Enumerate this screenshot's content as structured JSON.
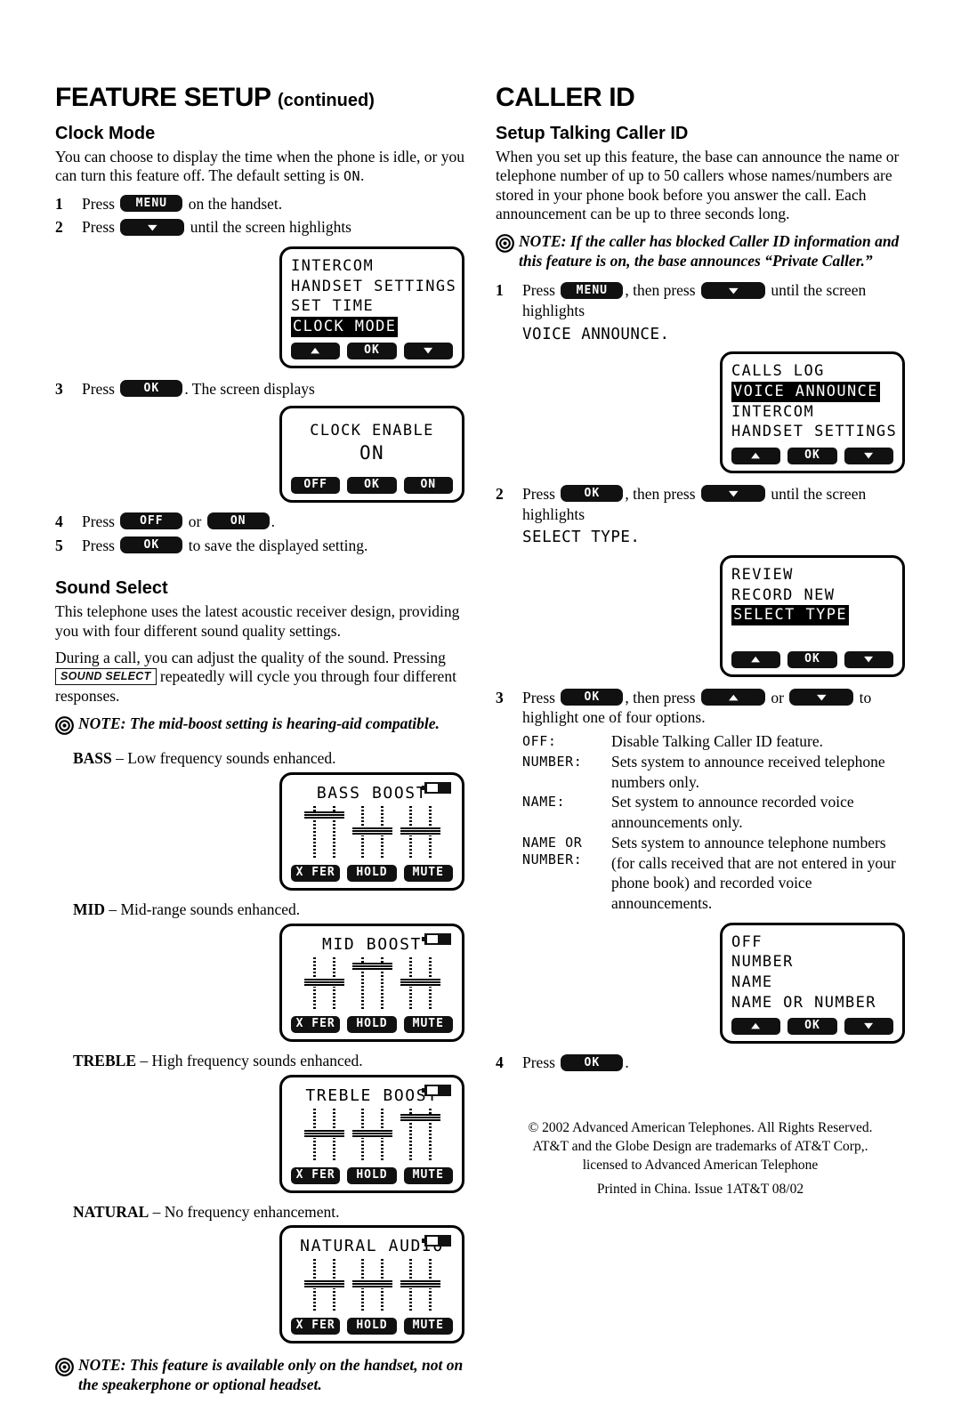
{
  "left": {
    "section_title": "FEATURE SETUP",
    "section_title_cont": "(continued)",
    "clock_mode": {
      "heading": "Clock Mode",
      "intro_a": "You can choose to display the time when the phone is idle, or you can turn this feature off. The default setting is ",
      "intro_default": "ON",
      "intro_b": ".",
      "step1_num": "1",
      "step1_a": "Press",
      "step1_key": "MENU",
      "step1_b": "on the handset.",
      "step2_num": "2",
      "step2_a": "Press",
      "step2_key": "▼",
      "step2_b": "until the screen highlights",
      "menu_screen": {
        "line1": "INTERCOM",
        "line2": "HANDSET SETTINGS",
        "line3": "SET TIME",
        "line4": "CLOCK MODE",
        "soft_left": "▲",
        "soft_mid": "OK",
        "soft_right": "▼"
      },
      "step3_num": "3",
      "step3_a": "Press",
      "step3_key": "OK",
      "step3_b": ". The screen displays",
      "enable_screen": {
        "line1": "CLOCK ENABLE",
        "line2": "ON",
        "soft_left": "OFF",
        "soft_mid": "OK",
        "soft_right": "ON"
      },
      "step4_num": "4",
      "step4_a": "Press",
      "step4_key1": "OFF",
      "step4_or": "or",
      "step4_key2": "ON",
      "step4_b": ".",
      "step5_num": "5",
      "step5_a": "Press",
      "step5_key": "OK",
      "step5_b": "to save the displayed setting."
    },
    "sound_select": {
      "heading": "Sound Select",
      "para1": "This telephone uses the latest acoustic receiver design, providing you with four different sound quality settings.",
      "para2_a": "During a call, you can adjust the quality of the sound.  Pressing",
      "para2_key": "SOUND SELECT",
      "para2_b": "repeatedly will cycle you through four different responses.",
      "note_label": "NOTE:",
      "note_text": "The mid-boost setting is hearing-aid compatible.",
      "modes": [
        {
          "name": "BASS",
          "dash": "–",
          "desc": "Low frequency sounds enhanced.",
          "screen_title": "BASS BOOST",
          "knobs": [
            "hi",
            "hi",
            "mid",
            "mid",
            "mid",
            "mid"
          ],
          "soft_left": "X FER",
          "soft_mid": "HOLD",
          "soft_right": "MUTE"
        },
        {
          "name": "MID",
          "dash": "–",
          "desc": "Mid-range sounds enhanced.",
          "screen_title": "MID BOOST",
          "knobs": [
            "mid",
            "mid",
            "hi",
            "hi",
            "mid",
            "mid"
          ],
          "soft_left": "X FER",
          "soft_mid": "HOLD",
          "soft_right": "MUTE"
        },
        {
          "name": "TREBLE",
          "dash": "–",
          "desc": "High frequency sounds enhanced.",
          "screen_title": "TREBLE BOOST",
          "knobs": [
            "mid",
            "mid",
            "mid",
            "mid",
            "hi",
            "hi"
          ],
          "soft_left": "X FER",
          "soft_mid": "HOLD",
          "soft_right": "MUTE"
        },
        {
          "name": "NATURAL",
          "dash": "–",
          "desc": "No frequency enhancement.",
          "screen_title": "NATURAL AUDIO",
          "knobs": [
            "mid",
            "mid",
            "mid",
            "mid",
            "mid",
            "mid"
          ],
          "soft_left": "X FER",
          "soft_mid": "HOLD",
          "soft_right": "MUTE"
        }
      ],
      "note2_label": "NOTE:",
      "note2_text": "This feature is available only on the handset, not on the speakerphone or optional headset."
    }
  },
  "right": {
    "section_title": "CALLER ID",
    "heading": "Setup Talking Caller ID",
    "intro": "When you set up this feature, the base can announce the name or telephone number of up to 50 callers whose names/numbers are stored in your phone book before you answer the call.  Each announcement can be up to three seconds long.",
    "note_label": "NOTE:",
    "note_text": "If the caller has blocked Caller ID information and this feature is on, the base announces “Private Caller.”",
    "step1_num": "1",
    "step1_a": "Press",
    "step1_key1": "MENU",
    "step1_b": ", then press",
    "step1_key2": "▼",
    "step1_c": "until the screen highlights",
    "step1_target": "VOICE ANNOUNCE.",
    "menu_screen": {
      "line1": "CALLS LOG",
      "line2": "VOICE ANNOUNCE",
      "line3": "INTERCOM",
      "line4": "HANDSET SETTINGS",
      "soft_left": "▲",
      "soft_mid": "OK",
      "soft_right": "▼"
    },
    "step2_num": "2",
    "step2_a": "Press",
    "step2_key1": "OK",
    "step2_b": ", then press",
    "step2_key2": "▼",
    "step2_c": "until the screen highlights",
    "step2_target": "SELECT TYPE.",
    "type_screen": {
      "line1": "REVIEW",
      "line2": "RECORD NEW",
      "line3": "SELECT TYPE",
      "line4": "",
      "soft_left": "▲",
      "soft_mid": "OK",
      "soft_right": "▼"
    },
    "step3_num": "3",
    "step3_a": "Press",
    "step3_key1": "OK",
    "step3_b": ", then press",
    "step3_key2": "▲",
    "step3_or": "or",
    "step3_key3": "▼",
    "step3_c": "to highlight one of four options.",
    "options": [
      {
        "term": "OFF:",
        "term2": "",
        "desc": "Disable Talking Caller ID feature."
      },
      {
        "term": "NUMBER:",
        "term2": "",
        "desc": "Sets system to announce received telephone numbers only."
      },
      {
        "term": "NAME:",
        "term2": "",
        "desc": "Set system to announce recorded voice announcements only."
      },
      {
        "term": "NAME OR",
        "term2": "NUMBER:",
        "desc": "Sets system to announce telephone numbers (for calls received that are not entered in your phone book) and recorded voice announcements."
      }
    ],
    "options_screen": {
      "line1": "OFF",
      "line2": "NUMBER",
      "line3": "NAME",
      "line4": "NAME OR NUMBER",
      "soft_left": "▲",
      "soft_mid": "OK",
      "soft_right": "▼"
    },
    "step4_num": "4",
    "step4_a": "Press",
    "step4_key": "OK",
    "step4_b": "."
  },
  "footer": {
    "line1": "© 2002 Advanced American Telephones.  All Rights Reserved.",
    "line2": "AT&T and the Globe Design are trademarks of AT&T Corp,.",
    "line3": "licensed to Advanced American Telephone",
    "line4": "Printed in China.  Issue 1AT&T  08/02"
  }
}
